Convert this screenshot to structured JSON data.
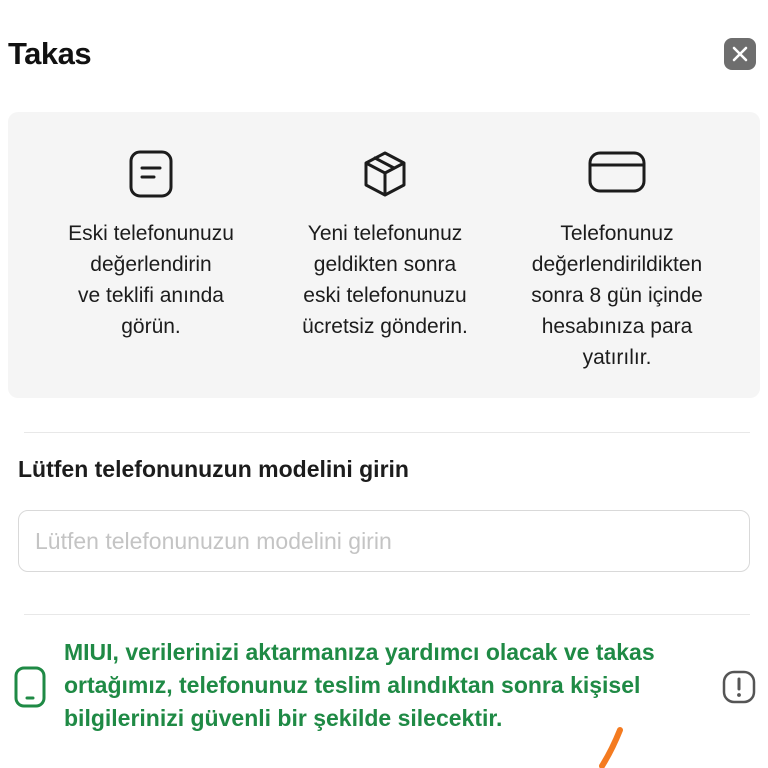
{
  "header": {
    "title": "Takas"
  },
  "steps": [
    {
      "icon": "document-icon",
      "text": "Eski telefonunuzu\ndeğerlendirin\nve teklifi anında\ngörün."
    },
    {
      "icon": "box-icon",
      "text": "Yeni telefonunuz\ngeldikten sonra\neski telefonunuzu\nücretsiz gönderin."
    },
    {
      "icon": "card-icon",
      "text": "Telefonunuz\ndeğerlendirildikten\nsonra 8 gün içinde\nhesabınıza para\nyatırılır."
    }
  ],
  "model": {
    "label": "Lütfen telefonunuzun modelini girin",
    "placeholder": "Lütfen telefonunuzun modelini girin",
    "value": ""
  },
  "notice": {
    "text": "MIUI, verilerinizi aktarmanıza yardımcı olacak ve takas\nortağımız, telefonunuz teslim alındıktan sonra kişisel\nbilgilerinizi güvenli bir şekilde silecektir.",
    "color": "#1f8a45"
  },
  "colors": {
    "close_bg": "#6e6e6e",
    "card_bg": "#f5f5f5",
    "accent_green": "#1f8a45",
    "annotation_orange": "#f47b20"
  }
}
